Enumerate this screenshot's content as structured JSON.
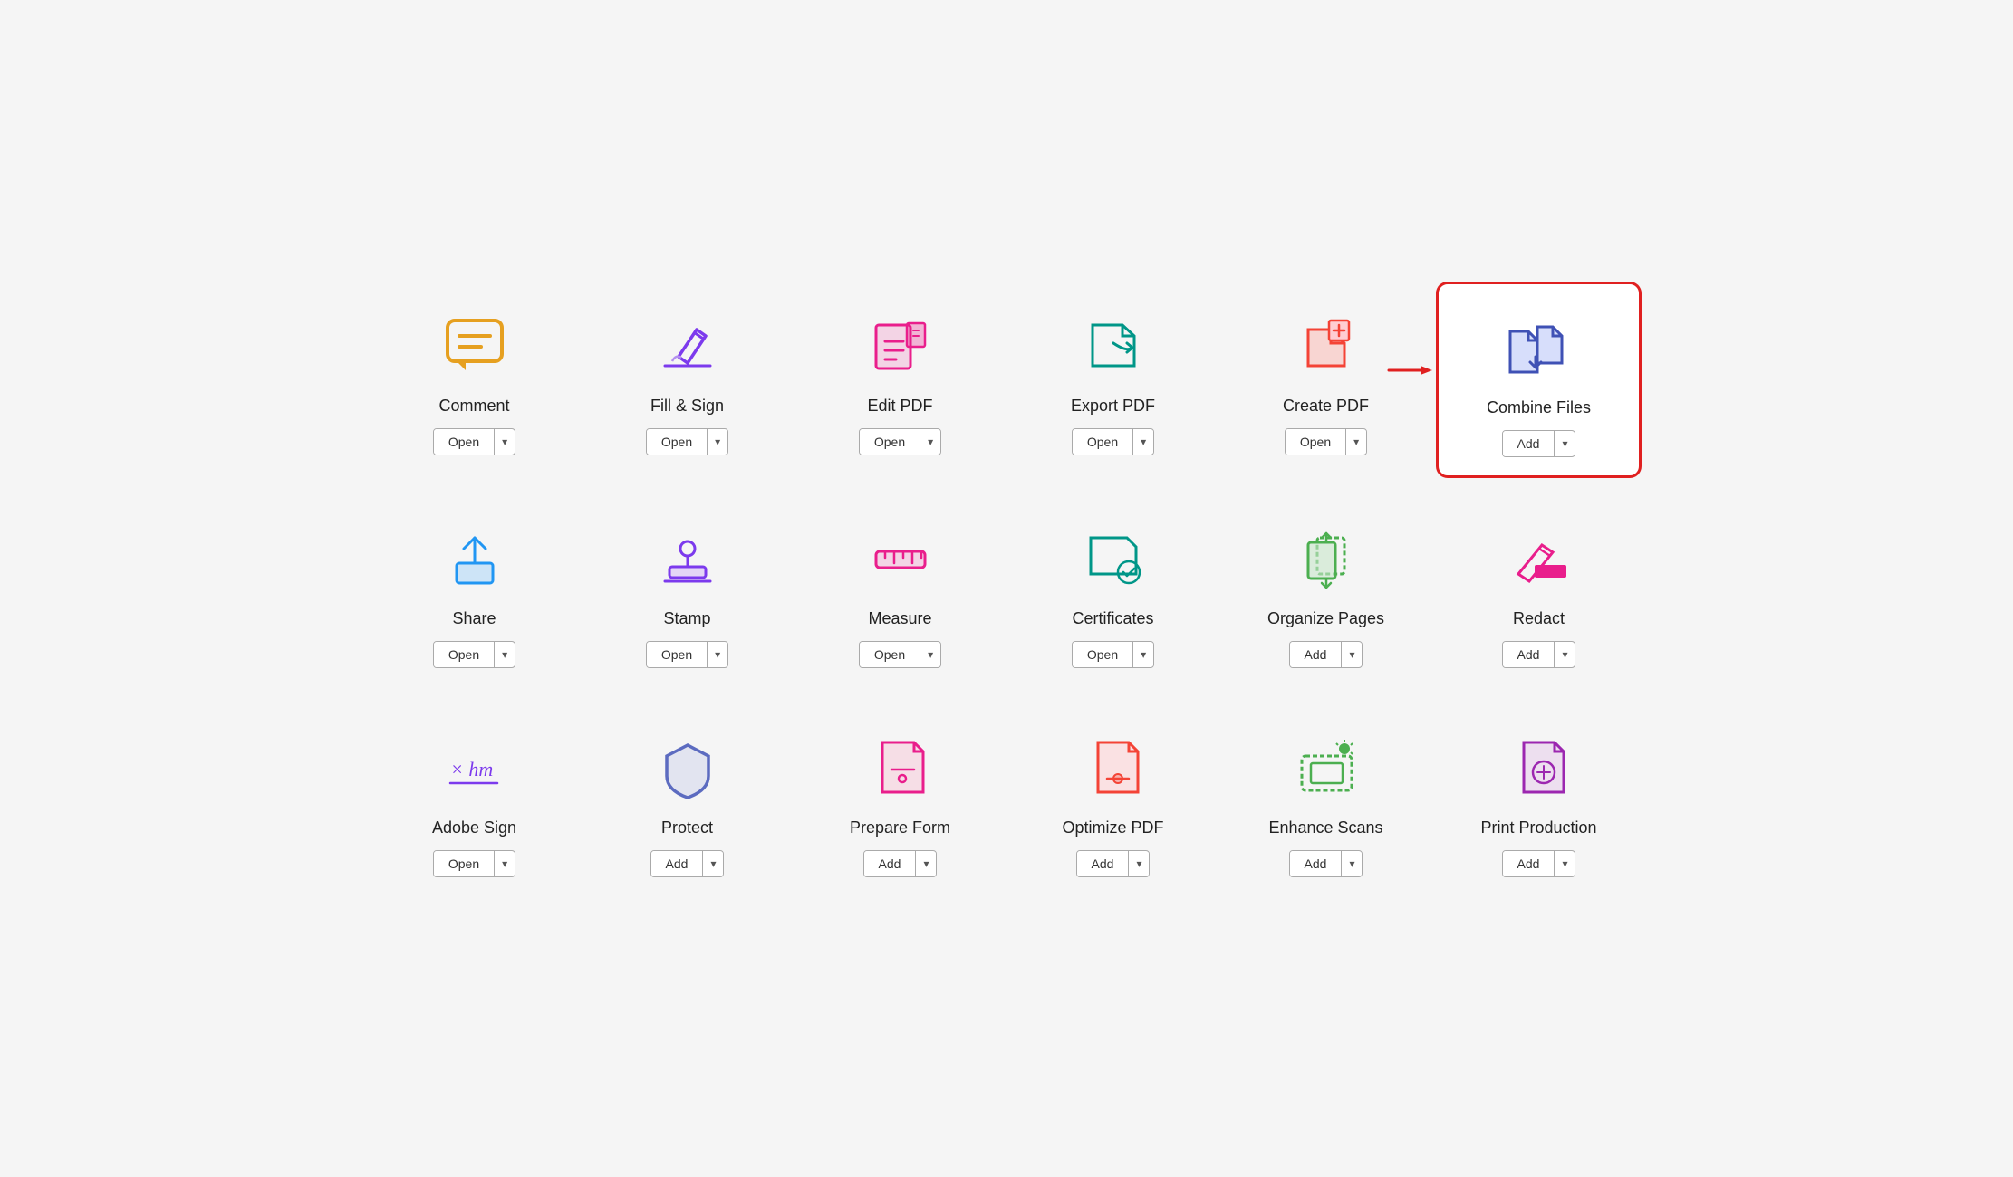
{
  "tools": [
    {
      "id": "comment",
      "label": "Comment",
      "btn_label": "Open",
      "highlighted": false,
      "icon_type": "comment"
    },
    {
      "id": "fill-sign",
      "label": "Fill & Sign",
      "btn_label": "Open",
      "highlighted": false,
      "icon_type": "fill-sign"
    },
    {
      "id": "edit-pdf",
      "label": "Edit PDF",
      "btn_label": "Open",
      "highlighted": false,
      "icon_type": "edit-pdf"
    },
    {
      "id": "export-pdf",
      "label": "Export PDF",
      "btn_label": "Open",
      "highlighted": false,
      "icon_type": "export-pdf"
    },
    {
      "id": "create-pdf",
      "label": "Create PDF",
      "btn_label": "Open",
      "highlighted": false,
      "icon_type": "create-pdf"
    },
    {
      "id": "combine-files",
      "label": "Combine Files",
      "btn_label": "Add",
      "highlighted": true,
      "icon_type": "combine-files"
    },
    {
      "id": "share",
      "label": "Share",
      "btn_label": "Open",
      "highlighted": false,
      "icon_type": "share"
    },
    {
      "id": "stamp",
      "label": "Stamp",
      "btn_label": "Open",
      "highlighted": false,
      "icon_type": "stamp"
    },
    {
      "id": "measure",
      "label": "Measure",
      "btn_label": "Open",
      "highlighted": false,
      "icon_type": "measure"
    },
    {
      "id": "certificates",
      "label": "Certificates",
      "btn_label": "Open",
      "highlighted": false,
      "icon_type": "certificates"
    },
    {
      "id": "organize-pages",
      "label": "Organize Pages",
      "btn_label": "Add",
      "highlighted": false,
      "icon_type": "organize-pages"
    },
    {
      "id": "redact",
      "label": "Redact",
      "btn_label": "Add",
      "highlighted": false,
      "icon_type": "redact"
    },
    {
      "id": "adobe-sign",
      "label": "Adobe Sign",
      "btn_label": "Open",
      "highlighted": false,
      "icon_type": "adobe-sign"
    },
    {
      "id": "protect",
      "label": "Protect",
      "btn_label": "Add",
      "highlighted": false,
      "icon_type": "protect"
    },
    {
      "id": "prepare-form",
      "label": "Prepare Form",
      "btn_label": "Add",
      "highlighted": false,
      "icon_type": "prepare-form"
    },
    {
      "id": "optimize-pdf",
      "label": "Optimize PDF",
      "btn_label": "Add",
      "highlighted": false,
      "icon_type": "optimize-pdf"
    },
    {
      "id": "enhance-scans",
      "label": "Enhance Scans",
      "btn_label": "Add",
      "highlighted": false,
      "icon_type": "enhance-scans"
    },
    {
      "id": "print-production",
      "label": "Print Production",
      "btn_label": "Add",
      "highlighted": false,
      "icon_type": "print-production"
    }
  ],
  "dropdown_symbol": "▾"
}
